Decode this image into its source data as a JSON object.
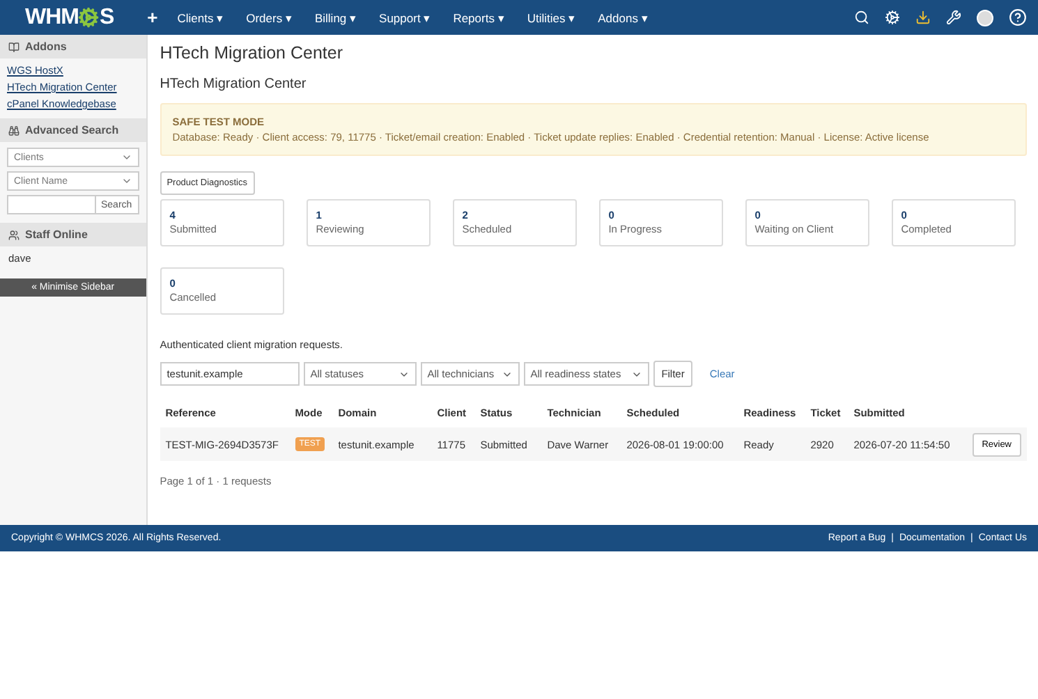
{
  "navbar": {
    "logo": {
      "before": "WHM",
      "after": "S"
    },
    "add_label": "+",
    "menus": [
      {
        "label": "Clients",
        "caret": "▾"
      },
      {
        "label": "Orders",
        "caret": "▾"
      },
      {
        "label": "Billing",
        "caret": "▾"
      },
      {
        "label": "Support",
        "caret": "▾"
      },
      {
        "label": "Reports",
        "caret": "▾"
      },
      {
        "label": "Utilities",
        "caret": "▾"
      },
      {
        "label": "Addons",
        "caret": "▾"
      }
    ],
    "icons": [
      {
        "kind": "search"
      },
      {
        "kind": "settings"
      },
      {
        "kind": "download"
      },
      {
        "kind": "wrench"
      },
      {
        "kind": "avatar"
      },
      {
        "kind": "help"
      }
    ]
  },
  "sidebar": {
    "addons": {
      "title": "Addons",
      "links": [
        "WGS HostX",
        "HTech Migration Center",
        "cPanel Knowledgebase"
      ]
    },
    "advanced_search": {
      "title": "Advanced Search",
      "selects": [
        "Clients",
        "Client Name"
      ],
      "button": "Search"
    },
    "staff_online": {
      "title": "Staff Online",
      "users": [
        "dave"
      ]
    },
    "minimise": "« Minimise Sidebar"
  },
  "page": {
    "title": "HTech Migration Center",
    "subtitle": "HTech Migration Center",
    "alert": {
      "title": "SAFE TEST MODE",
      "text": "Database: Ready · Client access: 79, 11775 · Ticket/email creation: Enabled · Ticket update replies: Enabled · Credential retention: Manual · License: Active license"
    },
    "diagnostics_button": "Product Diagnostics",
    "stats": [
      {
        "count": "4",
        "label": "Submitted"
      },
      {
        "count": "1",
        "label": "Reviewing"
      },
      {
        "count": "2",
        "label": "Scheduled"
      },
      {
        "count": "0",
        "label": "In Progress"
      },
      {
        "count": "0",
        "label": "Waiting on Client"
      },
      {
        "count": "0",
        "label": "Completed"
      },
      {
        "count": "0",
        "label": "Cancelled"
      }
    ],
    "intro": "Authenticated client migration requests.",
    "filters": {
      "search_value": "testunit.example",
      "selects": [
        "All statuses",
        "All technicians",
        "All readiness states"
      ],
      "filter_button": "Filter",
      "clear_link": "Clear"
    },
    "table": {
      "columns": [
        "Reference",
        "Mode",
        "Domain",
        "Client",
        "Status",
        "Technician",
        "Scheduled",
        "Readiness",
        "Ticket",
        "Submitted"
      ],
      "rows": [
        {
          "reference": "TEST-MIG-2694D3573F",
          "mode": "TEST",
          "domain": "testunit.example",
          "client": "11775",
          "status": "Submitted",
          "technician": "Dave Warner",
          "scheduled": "2026-08-01 19:00:00",
          "readiness": "Ready",
          "ticket": "2920",
          "submitted": "2026-07-20 11:54:50",
          "action": "Review"
        }
      ]
    },
    "pagination": "Page 1 of 1 · 1 requests"
  },
  "footer": {
    "copyright": "Copyright © WHMCS 2026. All Rights Reserved.",
    "links": [
      "Report a Bug",
      "Documentation",
      "Contact Us"
    ],
    "separator": "|"
  }
}
